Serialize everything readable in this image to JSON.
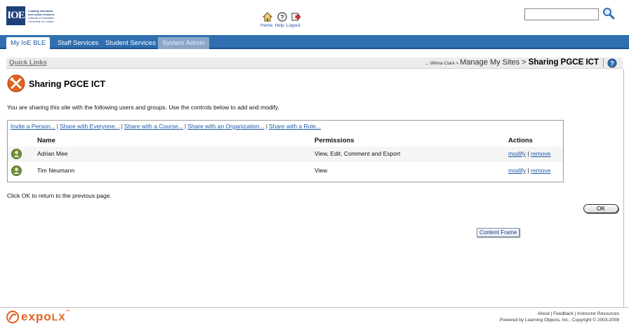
{
  "colors": {
    "brand_blue": "#2f6fb0",
    "link_blue": "#1f5aa6",
    "expo_orange": "#e2611c"
  },
  "header": {
    "logo": {
      "mark": "IOE",
      "line1": "Leading education",
      "line2": "and social research",
      "line3": "Institute of Education",
      "line4": "University of London"
    },
    "nav": {
      "home": "Home",
      "help": "Help",
      "logout": "Logout"
    },
    "search": {
      "value": "",
      "placeholder": ""
    }
  },
  "tabs": [
    {
      "label": "My IoE BLE"
    },
    {
      "label": "Staff Services"
    },
    {
      "label": "Student Services"
    },
    {
      "label": "System Admin"
    }
  ],
  "quicklinks": "Quick Links",
  "breadcrumb": {
    "user": "... Wilma Clark",
    "sep1": " > ",
    "parent": "Manage My Sites",
    "sep2": " > ",
    "current": "Sharing PGCE ICT"
  },
  "page": {
    "title": "Sharing PGCE ICT",
    "intro": "You are sharing this site with the following users and groups. Use the controls below to add and modify."
  },
  "share_links": [
    "Invite a Person...",
    "Share with Everyone...",
    "Share with a Course...",
    "Share with an Organization...",
    "Share with a Role..."
  ],
  "table": {
    "headers": {
      "name": "Name",
      "permissions": "Permissions",
      "actions": "Actions"
    },
    "rows": [
      {
        "name": "Adrian Mee",
        "permissions": "View, Edit, Comment and Export",
        "modify": "modify",
        "divider": "|",
        "remove": "remove"
      },
      {
        "name": "Tim Neumann",
        "permissions": "View",
        "modify": "modify",
        "divider": "|",
        "remove": "remove"
      }
    ]
  },
  "ok_note": "Click OK to return to the previous page.",
  "ok_button": "OK",
  "content_frame": "Content Frame",
  "footer": {
    "brand": "expo",
    "brand_lx": "LX",
    "brand_tm": "™",
    "links": "About | Feedback | Instructor Resources",
    "powered": "Powered by Learning Objects, Inc., Copyright © 2003-2008"
  }
}
